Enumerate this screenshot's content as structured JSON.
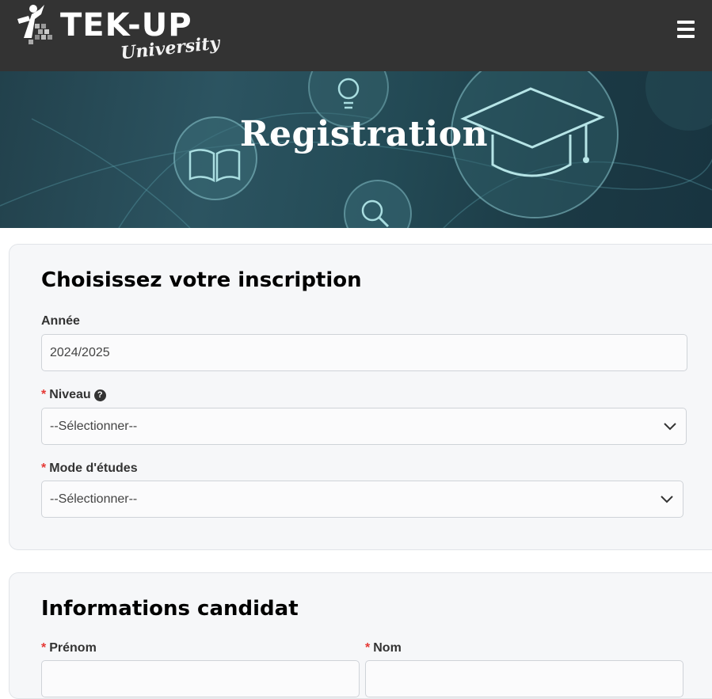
{
  "header": {
    "logo_text": "TEK-UP",
    "logo_subtext": "University",
    "menu_icon": "hamburger-menu-icon"
  },
  "banner": {
    "title": "Registration",
    "icons": [
      "book-icon",
      "lightbulb-icon",
      "graduation-cap-icon",
      "search-icon"
    ]
  },
  "inscription": {
    "title": "Choisissez votre inscription",
    "annee": {
      "label": "Année",
      "value": "2024/2025"
    },
    "niveau": {
      "required": "*",
      "label": "Niveau",
      "help_icon": "question-circle-icon",
      "value": "--Sélectionner--"
    },
    "mode": {
      "required": "*",
      "label": "Mode d'études",
      "value": "--Sélectionner--"
    }
  },
  "candidat": {
    "title": "Informations candidat",
    "prenom": {
      "required": "*",
      "label": "Prénom",
      "value": ""
    },
    "nom": {
      "required": "*",
      "label": "Nom",
      "value": ""
    }
  },
  "colors": {
    "header_bg": "#333333",
    "banner_bg": "#234a55",
    "required": "#e53935",
    "card_bg": "#f6f7f9"
  }
}
